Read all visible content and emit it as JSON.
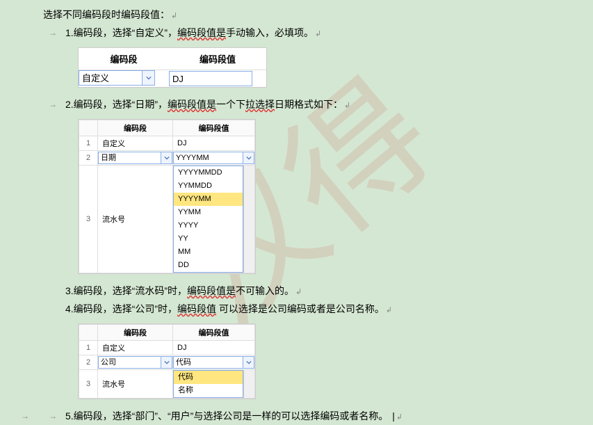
{
  "watermark": "汉得",
  "lines": {
    "heading": "选择不同编码段时编码段值：",
    "n1_pre": "1.编码段，选择“自定义”，",
    "n1_u": "编码段值是",
    "n1_post": "手动输入，必填项。",
    "n2_pre": "2.编码段，选择“日期”，",
    "n2_u": "编码段值是",
    "n2_post": "一个下",
    "n2_u2": "拉选择",
    "n2_post2": "日期格式如下：",
    "n3_pre": "3.编码段，选择“流水码”时，",
    "n3_u": "编码段值是",
    "n3_post": "不可输入的。",
    "n4_pre": "4.编码段，选择“公司”时，",
    "n4_u": "编码段值",
    "n4_post": " 可以选择是公司编码或者是公司名称。",
    "n5": "5.编码段，选择“部门”、“用户”与选择公司是一样的可以选择编码或者名称。"
  },
  "headers": {
    "col1": "编码段",
    "col2": "编码段值"
  },
  "img1": {
    "type_val": "自定义",
    "value": "DJ"
  },
  "img2": {
    "rows": [
      {
        "n": "1",
        "c1": "自定义",
        "c2": "DJ"
      },
      {
        "n": "2",
        "c1": "日期",
        "c2": "YYYYMM"
      },
      {
        "n": "3",
        "c1": "流水号",
        "c2": ""
      }
    ],
    "dropdown": [
      "YYYYMMDD",
      "YYMMDD",
      "YYYYMM",
      "YYMM",
      "YYYY",
      "YY",
      "MM",
      "DD"
    ],
    "selected": "YYYYMM"
  },
  "img3": {
    "rows": [
      {
        "n": "1",
        "c1": "自定义",
        "c2": "DJ"
      },
      {
        "n": "2",
        "c1": "公司",
        "c2": "代码"
      },
      {
        "n": "3",
        "c1": "流水号",
        "c2": ""
      }
    ],
    "dropdown": [
      "代码",
      "名称"
    ],
    "selected": "代码"
  }
}
